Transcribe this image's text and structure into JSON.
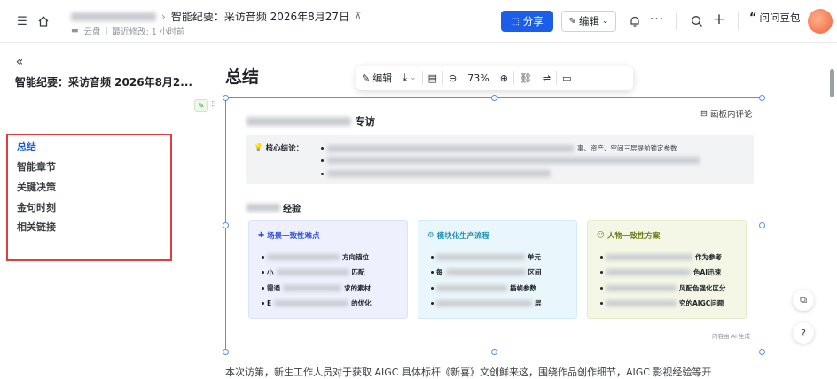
{
  "header": {
    "doc_title": "智能纪要：采访音频 2026年8月27日",
    "location": "云盘",
    "last_modified": "最近修改: 1 小时前",
    "share_label": "分享",
    "edit_label": "编辑",
    "user_label": "问问豆包"
  },
  "sidebar": {
    "doc_title": "智能纪要：采访音频 2026年8月2...",
    "toc": [
      {
        "label": "总结",
        "active": true
      },
      {
        "label": "智能章节",
        "active": false
      },
      {
        "label": "关键决策",
        "active": false
      },
      {
        "label": "金句时刻",
        "active": false
      },
      {
        "label": "相关链接",
        "active": false
      }
    ]
  },
  "main": {
    "heading": "总结",
    "toolbar": {
      "edit_label": "编辑",
      "zoom": "73%"
    },
    "board": {
      "title_suffix": "专访",
      "comment_label": "画板内评论",
      "conclusion_label": "核心结论：",
      "conclusion_line1_tail": "事、资产、空间三层提前锁定参数",
      "section2_suffix": "经验",
      "cards": [
        {
          "title": "场景一致性难点",
          "bg": "#eef1fd",
          "accent": "#2f4fd8",
          "items": [
            "方向锚位",
            "匹配",
            "求的素材",
            "的优化"
          ],
          "prefixes": [
            "",
            "小",
            "需通",
            "E"
          ]
        },
        {
          "title": "模块化生产流程",
          "bg": "#e9f6fb",
          "accent": "#1f8fb6",
          "items": [
            "单元",
            "区间",
            "插帧参数",
            "层"
          ],
          "prefixes": [
            "",
            "每",
            "",
            ""
          ]
        },
        {
          "title": "人物一致性方案",
          "bg": "#f4f7e6",
          "accent": "#6b7d1e",
          "items": [
            "作为参考",
            "色AI迅速",
            "风配色强化区分",
            "究的AIGC问题"
          ],
          "prefixes": [
            "",
            "",
            "",
            ""
          ]
        }
      ],
      "ai_note": "内容由 AI 生成"
    },
    "body_text": "本次访第，新生工作人员对于获取 AIGC 具体标杆《新喜》文创鲜来这，围绕作品创作细节，AIGC 影视经验等开"
  }
}
